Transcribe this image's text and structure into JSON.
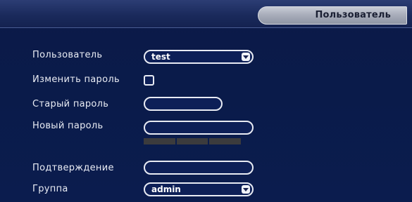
{
  "header": {
    "tab_title": "Пользователь"
  },
  "form": {
    "user_label": "Пользователь",
    "user_value": "test",
    "change_password_label": "Изменить пароль",
    "change_password_checked": false,
    "old_password_label": "Старый пароль",
    "new_password_label": "Новый пароль",
    "confirm_label": "Подтверждение",
    "group_label": "Группа",
    "group_value": "admin"
  },
  "colors": {
    "background": "#0a1b4a",
    "text": "#e9ecf4",
    "field_border": "#e8ebf3",
    "strength_bar": "#3b3b3d"
  }
}
